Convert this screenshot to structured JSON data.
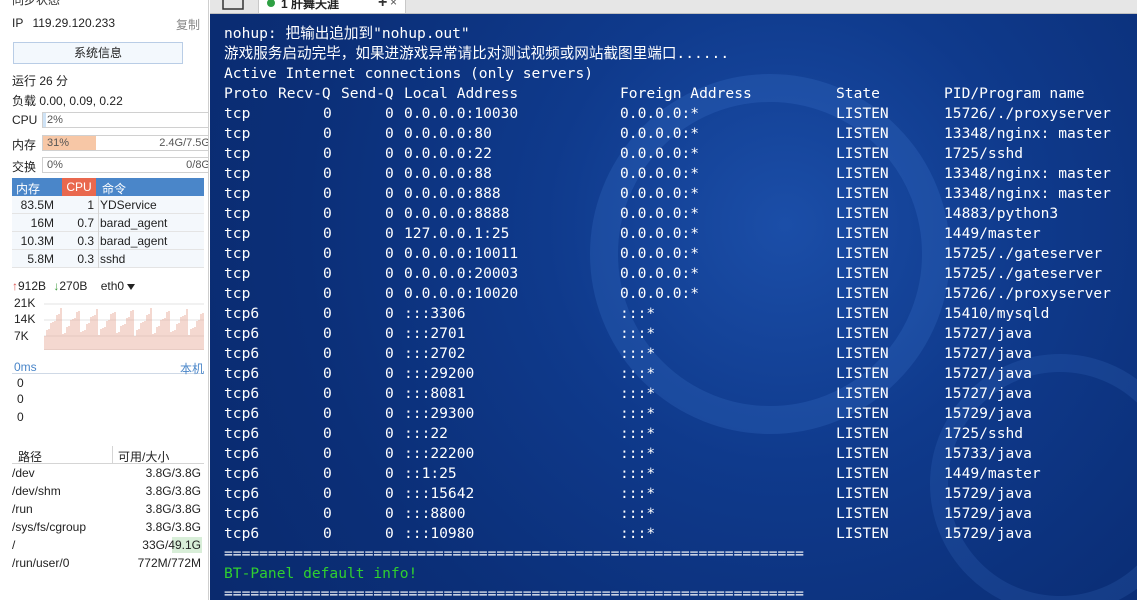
{
  "sidebar": {
    "sync_label": "同步状态",
    "ip_label": "IP",
    "ip_value": "119.29.120.233",
    "copy_label": "复制",
    "system_info_button": "系统信息",
    "uptime": "运行 26 分",
    "load": "负载 0.00, 0.09, 0.22",
    "cpu": {
      "label": "CPU",
      "percent_text": "2%",
      "percent": 2
    },
    "mem": {
      "label": "内存",
      "percent_text": "31%",
      "percent": 31,
      "value": "2.4G/7.5G"
    },
    "swap": {
      "label": "交换",
      "percent_text": "0%",
      "percent": 0,
      "value": "0/8G"
    },
    "process_headers": {
      "mem": "内存",
      "cpu": "CPU",
      "cmd": "命令"
    },
    "processes": [
      {
        "mem": "83.5M",
        "cpu": "1",
        "cmd": "YDService"
      },
      {
        "mem": "16M",
        "cpu": "0.7",
        "cmd": "barad_agent"
      },
      {
        "mem": "10.3M",
        "cpu": "0.3",
        "cmd": "barad_agent"
      },
      {
        "mem": "5.8M",
        "cpu": "0.3",
        "cmd": "sshd"
      }
    ],
    "net": {
      "up": "912B",
      "down": "270B",
      "iface": "eth0"
    },
    "net_chart_labels": [
      "21K",
      "14K",
      "7K"
    ],
    "latency": {
      "ms": "0ms",
      "node": "本机",
      "values": [
        "0",
        "0",
        "0"
      ]
    },
    "disk_headers": {
      "path": "路径",
      "size": "可用/大小"
    },
    "disks": [
      {
        "path": "/dev",
        "size": "3.8G/3.8G",
        "used": 0
      },
      {
        "path": "/dev/shm",
        "size": "3.8G/3.8G",
        "used": 0
      },
      {
        "path": "/run",
        "size": "3.8G/3.8G",
        "used": 0
      },
      {
        "path": "/sys/fs/cgroup",
        "size": "3.8G/3.8G",
        "used": 0
      },
      {
        "path": "/",
        "size": "33G/49.1G",
        "used": 0.33
      },
      {
        "path": "/run/user/0",
        "size": "772M/772M",
        "used": 0
      }
    ]
  },
  "tabs": [
    {
      "label": "1 肝舞天涯",
      "close": "×"
    }
  ],
  "tab_add": "+",
  "terminal": {
    "intro": [
      "nohup: 把输出追加到\"nohup.out\"",
      "游戏服务启动完毕，如果进游戏异常请比对测试视频或网站截图里端口......",
      "Active Internet connections (only servers)"
    ],
    "headers": [
      "Proto",
      "Recv-Q",
      "Send-Q",
      "Local Address",
      "Foreign Address",
      "State",
      "PID/Program name"
    ],
    "rows": [
      [
        "tcp",
        "0",
        "0",
        "0.0.0.0:10030",
        "0.0.0.0:*",
        "LISTEN",
        "15726/./proxyserver"
      ],
      [
        "tcp",
        "0",
        "0",
        "0.0.0.0:80",
        "0.0.0.0:*",
        "LISTEN",
        "13348/nginx: master"
      ],
      [
        "tcp",
        "0",
        "0",
        "0.0.0.0:22",
        "0.0.0.0:*",
        "LISTEN",
        "1725/sshd"
      ],
      [
        "tcp",
        "0",
        "0",
        "0.0.0.0:88",
        "0.0.0.0:*",
        "LISTEN",
        "13348/nginx: master"
      ],
      [
        "tcp",
        "0",
        "0",
        "0.0.0.0:888",
        "0.0.0.0:*",
        "LISTEN",
        "13348/nginx: master"
      ],
      [
        "tcp",
        "0",
        "0",
        "0.0.0.0:8888",
        "0.0.0.0:*",
        "LISTEN",
        "14883/python3"
      ],
      [
        "tcp",
        "0",
        "0",
        "127.0.0.1:25",
        "0.0.0.0:*",
        "LISTEN",
        "1449/master"
      ],
      [
        "tcp",
        "0",
        "0",
        "0.0.0.0:10011",
        "0.0.0.0:*",
        "LISTEN",
        "15725/./gateserver"
      ],
      [
        "tcp",
        "0",
        "0",
        "0.0.0.0:20003",
        "0.0.0.0:*",
        "LISTEN",
        "15725/./gateserver"
      ],
      [
        "tcp",
        "0",
        "0",
        "0.0.0.0:10020",
        "0.0.0.0:*",
        "LISTEN",
        "15726/./proxyserver"
      ],
      [
        "tcp6",
        "0",
        "0",
        ":::3306",
        ":::*",
        "LISTEN",
        "15410/mysqld"
      ],
      [
        "tcp6",
        "0",
        "0",
        ":::2701",
        ":::*",
        "LISTEN",
        "15727/java"
      ],
      [
        "tcp6",
        "0",
        "0",
        ":::2702",
        ":::*",
        "LISTEN",
        "15727/java"
      ],
      [
        "tcp6",
        "0",
        "0",
        ":::29200",
        ":::*",
        "LISTEN",
        "15727/java"
      ],
      [
        "tcp6",
        "0",
        "0",
        ":::8081",
        ":::*",
        "LISTEN",
        "15727/java"
      ],
      [
        "tcp6",
        "0",
        "0",
        ":::29300",
        ":::*",
        "LISTEN",
        "15729/java"
      ],
      [
        "tcp6",
        "0",
        "0",
        ":::22",
        ":::*",
        "LISTEN",
        "1725/sshd"
      ],
      [
        "tcp6",
        "0",
        "0",
        ":::22200",
        ":::*",
        "LISTEN",
        "15733/java"
      ],
      [
        "tcp6",
        "0",
        "0",
        "::1:25",
        ":::*",
        "LISTEN",
        "1449/master"
      ],
      [
        "tcp6",
        "0",
        "0",
        ":::15642",
        ":::*",
        "LISTEN",
        "15729/java"
      ],
      [
        "tcp6",
        "0",
        "0",
        ":::8800",
        ":::*",
        "LISTEN",
        "15729/java"
      ],
      [
        "tcp6",
        "0",
        "0",
        ":::10980",
        ":::*",
        "LISTEN",
        "15729/java"
      ]
    ],
    "separator": "==================================================================",
    "bt_panel": "BT-Panel default info!"
  },
  "colors": {
    "terminal_bg": "#0f3a8c",
    "terminal_text": "#ffffff",
    "bt_green": "#2fd02f",
    "mem_fill": "#f7c7a6",
    "proc_head": "#4a86c9",
    "proc_cpu_head": "#e9684e"
  }
}
